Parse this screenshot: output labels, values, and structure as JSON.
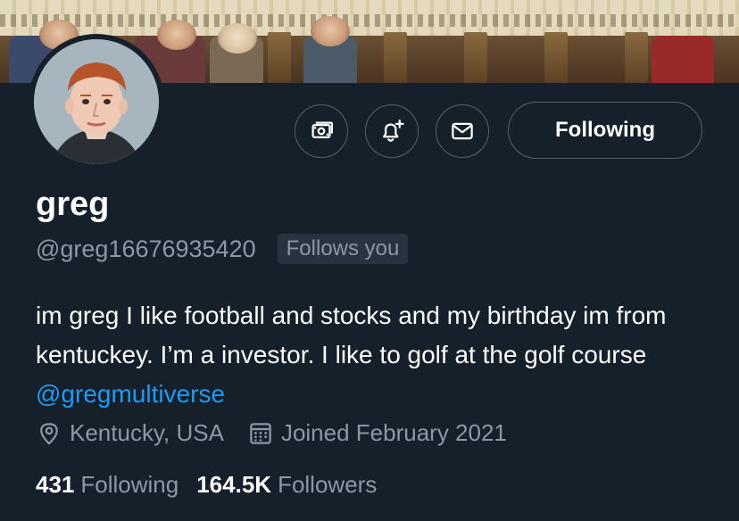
{
  "profile": {
    "name": "greg",
    "handle": "@greg16676935420",
    "follows_you_badge": "Follows you",
    "bio": {
      "text": "im greg I like football and stocks and my birthday im from kentuckey. I’m a investor. I like to golf at the golf course ",
      "mention": "@gregmultiverse"
    },
    "location": "Kentucky, USA",
    "joined": "Joined February 2021",
    "following_count": "431",
    "following_label": "Following",
    "followers_count": "164.5K",
    "followers_label": "Followers"
  },
  "actions": {
    "tip_icon": "money-icon",
    "notify_icon": "bell-plus-icon",
    "message_icon": "envelope-icon",
    "follow_state_label": "Following"
  },
  "colors": {
    "background": "#15202b",
    "primary_text": "#ffffff",
    "secondary_text": "#8b98a5",
    "link": "#1d9bf0",
    "border": "#536471",
    "badge_bg": "#273340"
  }
}
